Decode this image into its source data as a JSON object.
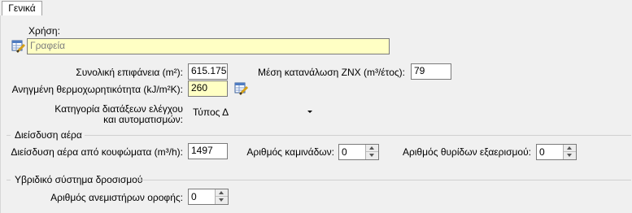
{
  "tabs": [
    {
      "label": "Γενικά"
    }
  ],
  "usage": {
    "label": "Χρήση:",
    "value": "Γραφεία"
  },
  "general": {
    "total_area_label": "Συνολική επιφάνεια (m²):",
    "total_area_value": "615.175",
    "avg_dhw_label": "Μέση κατανάλωση ZNX (m³/έτος):",
    "avg_dhw_value": "79",
    "heat_capacity_label": "Ανηγμένη θερμοχωρητικότητα (kJ/m²K):",
    "heat_capacity_value": "260",
    "control_category_label_line1": "Κατηγορία διατάξεων ελέγχου",
    "control_category_label_line2": "και αυτοματισμών:",
    "control_category_value": "Τύπος Δ"
  },
  "infiltration": {
    "group_title": "Διείσδυση αέρα",
    "frames_label": "Διείσδυση αέρα από κουφώματα (m³/h):",
    "frames_value": "1497",
    "chimneys_label": "Αριθμός καμινάδων:",
    "chimneys_value": "0",
    "vents_label": "Αριθμός θυρίδων εξαερισμού:",
    "vents_value": "0"
  },
  "hybrid_cooling": {
    "group_title": "Υβριδικό σύστημα δροσισμού",
    "ceiling_fans_label": "Αριθμός ανεμιστήρων οροφής:",
    "ceiling_fans_value": "0"
  },
  "icons": {
    "edit": "edit-table-icon"
  }
}
